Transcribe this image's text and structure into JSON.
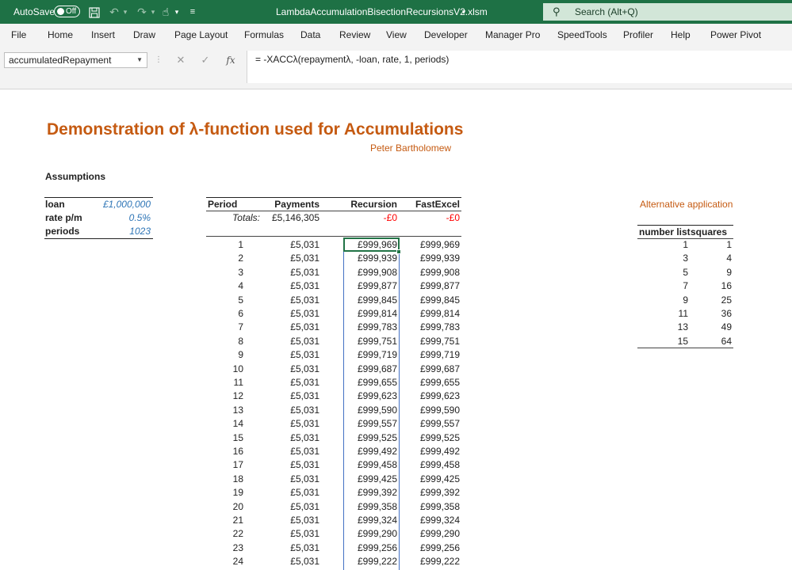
{
  "titlebar": {
    "autosave_label": "AutoSave",
    "autosave_state": "Off",
    "filename": "LambdaAccumulationBisectionRecursionsV2.xlsm",
    "search_placeholder": "Search (Alt+Q)"
  },
  "menu": [
    "File",
    "Home",
    "Insert",
    "Draw",
    "Page Layout",
    "Formulas",
    "Data",
    "Review",
    "View",
    "Developer",
    "Manager Pro",
    "SpeedTools",
    "Profiler",
    "Help",
    "Power Pivot"
  ],
  "formula_bar": {
    "name_box": "accumulatedRepayment",
    "formula": "= -XACCλ(repaymentλ, -loan, rate, 1, periods)"
  },
  "sheet": {
    "title": "Demonstration of λ-function used for Accumulations",
    "author": "Peter Bartholomew",
    "assumptions_heading": "Assumptions",
    "assumptions": [
      {
        "label": "loan",
        "value": "£1,000,000"
      },
      {
        "label": "rate p/m",
        "value": "0.5%"
      },
      {
        "label": "periods",
        "value": "1023"
      }
    ],
    "table": {
      "headers": [
        "Period",
        "Payments",
        "Recursion",
        "FastExcel"
      ],
      "totals_label": "Totals:",
      "totals": [
        "£5,146,305",
        "-£0",
        "-£0"
      ],
      "rows": [
        [
          "1",
          "£5,031",
          "£999,969",
          "£999,969"
        ],
        [
          "2",
          "£5,031",
          "£999,939",
          "£999,939"
        ],
        [
          "3",
          "£5,031",
          "£999,908",
          "£999,908"
        ],
        [
          "4",
          "£5,031",
          "£999,877",
          "£999,877"
        ],
        [
          "5",
          "£5,031",
          "£999,845",
          "£999,845"
        ],
        [
          "6",
          "£5,031",
          "£999,814",
          "£999,814"
        ],
        [
          "7",
          "£5,031",
          "£999,783",
          "£999,783"
        ],
        [
          "8",
          "£5,031",
          "£999,751",
          "£999,751"
        ],
        [
          "9",
          "£5,031",
          "£999,719",
          "£999,719"
        ],
        [
          "10",
          "£5,031",
          "£999,687",
          "£999,687"
        ],
        [
          "11",
          "£5,031",
          "£999,655",
          "£999,655"
        ],
        [
          "12",
          "£5,031",
          "£999,623",
          "£999,623"
        ],
        [
          "13",
          "£5,031",
          "£999,590",
          "£999,590"
        ],
        [
          "14",
          "£5,031",
          "£999,557",
          "£999,557"
        ],
        [
          "15",
          "£5,031",
          "£999,525",
          "£999,525"
        ],
        [
          "16",
          "£5,031",
          "£999,492",
          "£999,492"
        ],
        [
          "17",
          "£5,031",
          "£999,458",
          "£999,458"
        ],
        [
          "18",
          "£5,031",
          "£999,425",
          "£999,425"
        ],
        [
          "19",
          "£5,031",
          "£999,392",
          "£999,392"
        ],
        [
          "20",
          "£5,031",
          "£999,358",
          "£999,358"
        ],
        [
          "21",
          "£5,031",
          "£999,324",
          "£999,324"
        ],
        [
          "22",
          "£5,031",
          "£999,290",
          "£999,290"
        ],
        [
          "23",
          "£5,031",
          "£999,256",
          "£999,256"
        ],
        [
          "24",
          "£5,031",
          "£999,222",
          "£999,222"
        ]
      ]
    },
    "alternative": {
      "title": "Alternative application",
      "headers": [
        "number list",
        "squares"
      ],
      "rows": [
        [
          "1",
          "1"
        ],
        [
          "3",
          "4"
        ],
        [
          "5",
          "9"
        ],
        [
          "7",
          "16"
        ],
        [
          "9",
          "25"
        ],
        [
          "11",
          "36"
        ],
        [
          "13",
          "49"
        ],
        [
          "15",
          "64"
        ]
      ]
    }
  },
  "colors": {
    "excel_green": "#1e7145",
    "title_orange": "#c55a11",
    "input_blue": "#2e75b6",
    "negative_red": "#ff0000",
    "selection_green": "#217346"
  },
  "icons": [
    "save-icon",
    "undo-icon",
    "redo-icon",
    "touch-mode-icon",
    "customize-qat-icon",
    "search-icon",
    "cancel-icon",
    "enter-icon",
    "insert-function-icon"
  ]
}
